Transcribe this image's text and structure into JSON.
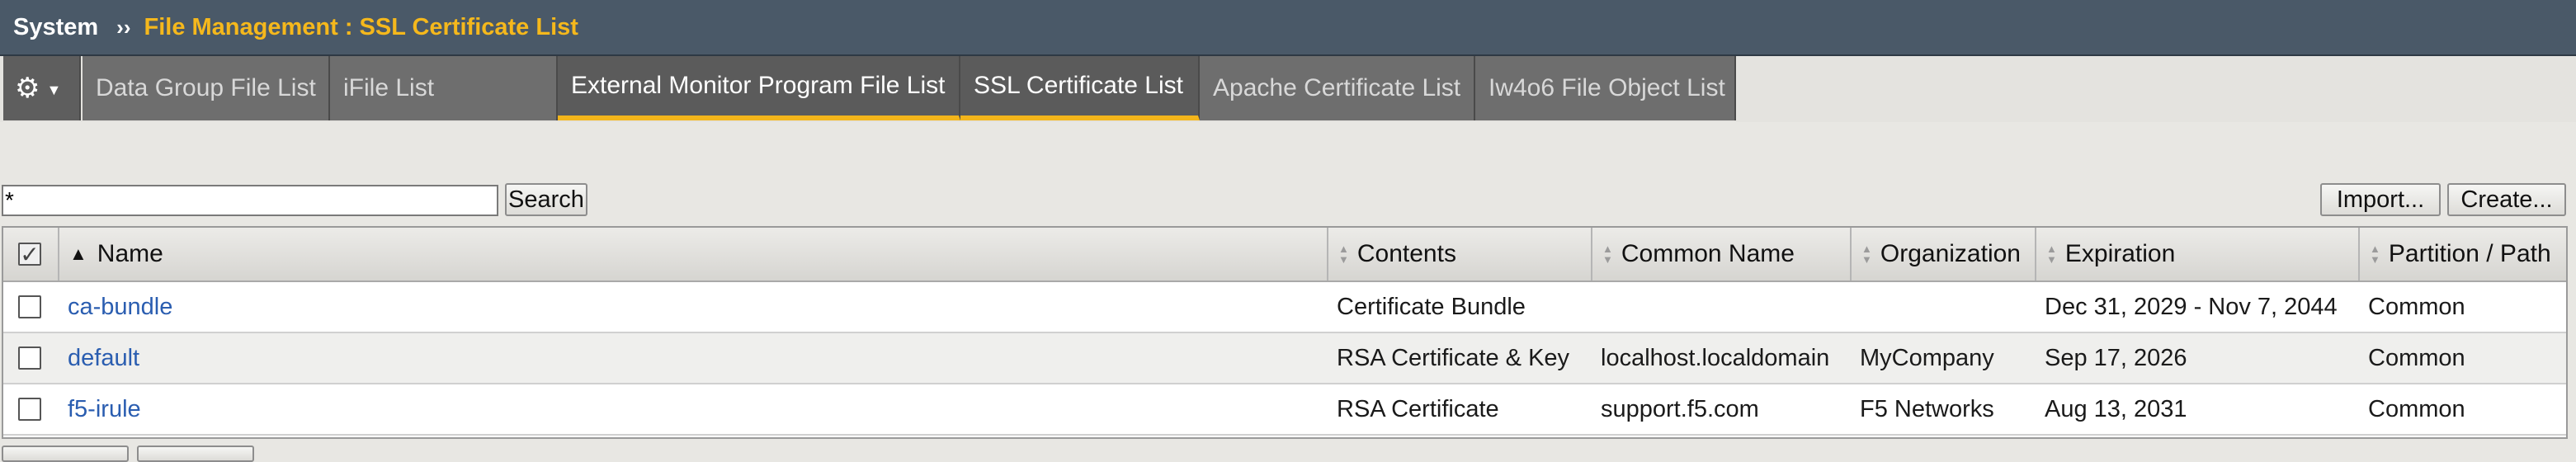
{
  "breadcrumb": {
    "root": "System",
    "separator": "››",
    "current": "File Management : SSL Certificate List"
  },
  "tabs": [
    {
      "label": "Data Group File List",
      "active": false
    },
    {
      "label": "iFile List",
      "active": false
    },
    {
      "label": "External Monitor Program File List",
      "active": true
    },
    {
      "label": "SSL Certificate List",
      "active": true
    },
    {
      "label": "Apache Certificate List",
      "active": false
    },
    {
      "label": "Iw4o6 File Object List",
      "active": false
    }
  ],
  "search": {
    "value": "*",
    "button_label": "Search"
  },
  "actions": {
    "import_label": "Import...",
    "create_label": "Create..."
  },
  "table": {
    "columns": [
      "Name",
      "Contents",
      "Common Name",
      "Organization",
      "Expiration",
      "Partition / Path"
    ],
    "rows": [
      {
        "name": "ca-bundle",
        "contents": "Certificate Bundle",
        "common_name": "",
        "organization": "",
        "expiration": "Dec 31, 2029 - Nov 7, 2044",
        "partition": "Common"
      },
      {
        "name": "default",
        "contents": "RSA Certificate & Key",
        "common_name": "localhost.localdomain",
        "organization": "MyCompany",
        "expiration": "Sep 17, 2026",
        "partition": "Common"
      },
      {
        "name": "f5-irule",
        "contents": "RSA Certificate",
        "common_name": "support.f5.com",
        "organization": "F5 Networks",
        "expiration": "Aug 13, 2031",
        "partition": "Common"
      }
    ]
  },
  "icons": {
    "gear": "gear-icon",
    "menu_caret": "chevron-down-icon"
  },
  "colors": {
    "title_bar": "#4a5968",
    "breadcrumb_current": "#f5b81c",
    "active_tab_underline": "#f3b51b",
    "link": "#2a5db0"
  }
}
